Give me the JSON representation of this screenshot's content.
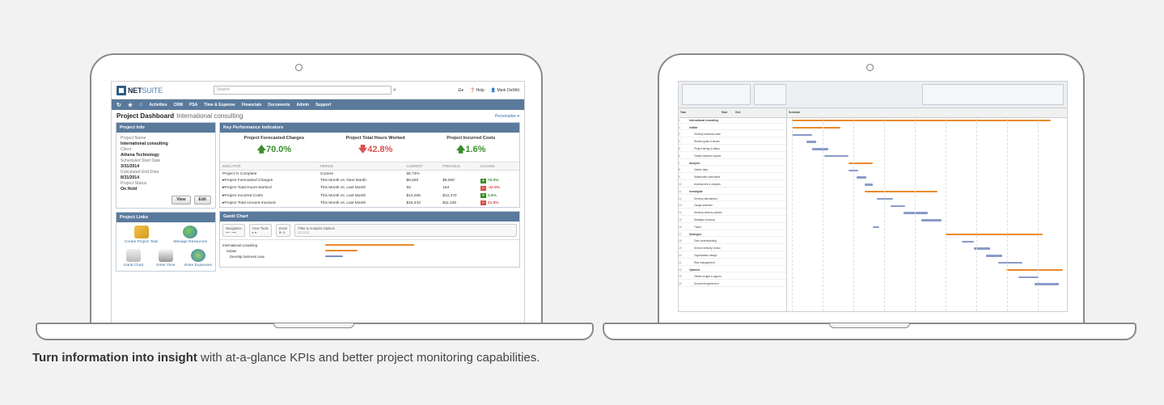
{
  "caption": {
    "bold": "Turn information into insight",
    "rest": " with at-a-glance KPIs and better project monitoring capabilities."
  },
  "netsuite": {
    "logo": {
      "a": "NET",
      "b": "SUITE"
    },
    "search_placeholder": "Search",
    "user": "Mark DeWitt",
    "help": "Help",
    "nav": [
      "Activities",
      "CRM",
      "PSA",
      "Time & Expense",
      "Financials",
      "Documents",
      "Admin",
      "Support"
    ],
    "dashboard_title": "Project Dashboard",
    "dashboard_sub": "International consulting",
    "personalize": "Personalize",
    "project_info": {
      "header": "Project Info",
      "fields": [
        {
          "label": "Project Name",
          "value": "International consulting"
        },
        {
          "label": "Client",
          "value": "Athena Technology"
        },
        {
          "label": "Scheduled Start Date",
          "value": "3/31/2014"
        },
        {
          "label": "Calculated End Date",
          "value": "8/31/2014"
        },
        {
          "label": "Project Status",
          "value": "On Hold"
        }
      ],
      "view_label": "View",
      "edit_label": "Edit"
    },
    "project_links": {
      "header": "Project Links",
      "links": [
        "Create Project Task",
        "Manage Resources"
      ],
      "links2": [
        "Gantt Chart",
        "Enter Time",
        "Enter Expenses"
      ]
    },
    "kpi": {
      "header": "Key Performance Indicators",
      "cards": [
        {
          "title": "Project Forecasted Charges",
          "value": "70.0%",
          "dir": "up"
        },
        {
          "title": "Project Total Hours Worked",
          "value": "42.8%",
          "dir": "down"
        },
        {
          "title": "Project Incurred Costs",
          "value": "1.6%",
          "dir": "up"
        }
      ],
      "columns": [
        "INDICATOR",
        "PERIOD",
        "CURRENT",
        "PREVIOUS",
        "CHANGE"
      ],
      "rows": [
        {
          "indicator": "Project % Complete",
          "period": "Current",
          "current": "66.73%",
          "previous": "",
          "change": "",
          "c": ""
        },
        {
          "indicator": "Project Forecasted Charges",
          "period": "This Month vs. Next Month",
          "current": "$8,500",
          "previous": "$5,000",
          "change": "70.0%",
          "c": "g"
        },
        {
          "indicator": "Project Total Hours Worked",
          "period": "This Month vs. Last Month",
          "current": "93",
          "previous": "163",
          "change": "-42.8%",
          "c": "r"
        },
        {
          "indicator": "Project Incurred Costs",
          "period": "This Month vs. Last Month",
          "current": "$12,265",
          "previous": "$12,470",
          "change": "1.6%",
          "c": "g"
        },
        {
          "indicator": "Project Total Amount Invoiced",
          "period": "This Month vs. Last Month",
          "current": "$15,443",
          "previous": "$11,150",
          "change": "31.8%",
          "c": "r"
        }
      ]
    },
    "gantt": {
      "header": "Gantt Chart",
      "tools": [
        "Navigation",
        "View Tools",
        "Zoom",
        "Filter & Analysis Options"
      ],
      "rows": [
        "International consulting",
        "Initiate",
        "Develop business case"
      ]
    }
  },
  "gantt_app": {
    "header_task": "Tasks",
    "header_schedule": "Schedule",
    "col_task": "Task",
    "col_start": "Start",
    "col_end": "End",
    "tasks": [
      "International consulting",
      "Initiate",
      "Develop business case",
      "Review goals & issues",
      "Project timing & status",
      "Clarify business require.",
      "Analysis",
      "Gather data",
      "Stakeholder interviews",
      "Assessment & analysis",
      "Investigate",
      "Develop alternatives",
      "Gauge selection",
      "Develop delivery options",
      "Strategic sourcing",
      "Travel",
      "Strategize",
      "Gain understanding",
      "Service delivery review",
      "Organization design",
      "Risk management",
      "Optimize",
      "Obtain budget & approv.",
      "Document agreement"
    ]
  }
}
